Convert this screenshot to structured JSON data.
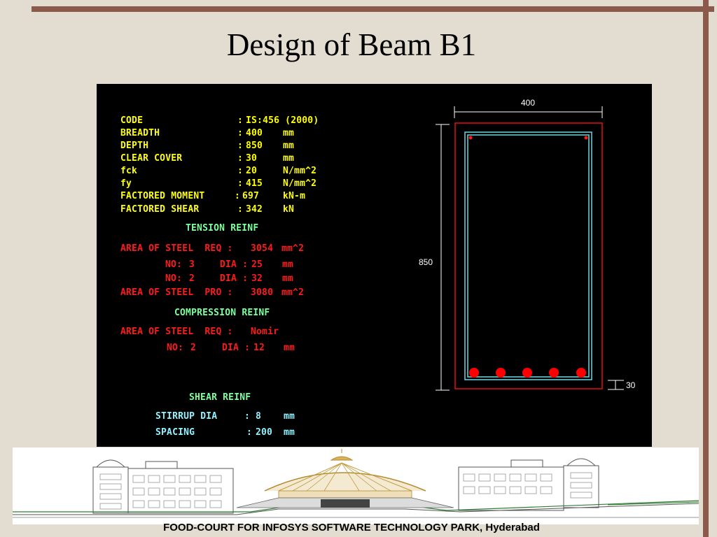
{
  "title": "Design of Beam B1",
  "params": [
    {
      "label": "CODE",
      "sep": ":",
      "value": "IS:456 (2000)",
      "unit": ""
    },
    {
      "label": "BREADTH",
      "sep": ":",
      "value": "400",
      "unit": "mm"
    },
    {
      "label": "DEPTH",
      "sep": ":",
      "value": "850",
      "unit": "mm"
    },
    {
      "label": "CLEAR COVER",
      "sep": ":",
      "value": "30",
      "unit": "mm"
    },
    {
      "label": "fck",
      "sep": ":",
      "value": "20",
      "unit": "N/mm^2"
    },
    {
      "label": "fy",
      "sep": ":",
      "value": "415",
      "unit": "N/mm^2"
    },
    {
      "label": "FACTORED MOMENT",
      "sep": ":",
      "value": "697",
      "unit": "kN-m"
    },
    {
      "label": "FACTORED SHEAR",
      "sep": ":",
      "value": "342",
      "unit": "kN"
    }
  ],
  "tension": {
    "heading": "TENSION REINF",
    "req_label": "AREA OF STEEL  REQ :",
    "req_value": "3054",
    "req_unit": "mm^2",
    "bars": [
      {
        "no_label": "NO:",
        "no": "3",
        "dia_label": "DIA :",
        "dia": "25",
        "unit": "mm"
      },
      {
        "no_label": "NO:",
        "no": "2",
        "dia_label": "DIA :",
        "dia": "32",
        "unit": "mm"
      }
    ],
    "pro_label": "AREA OF STEEL  PRO :",
    "pro_value": "3080",
    "pro_unit": "mm^2"
  },
  "compression": {
    "heading": "COMPRESSION REINF",
    "req_label": "AREA OF STEEL  REQ :",
    "req_value": "Nomir",
    "bar": {
      "no_label": "NO:",
      "no": "2",
      "dia_label": "DIA :",
      "dia": "12",
      "unit": "mm"
    }
  },
  "shear": {
    "heading": "SHEAR REINF",
    "stirrup_label": "STIRRUP DIA",
    "stirrup_value": "8",
    "stirrup_unit": "mm",
    "spacing_label": "SPACING",
    "spacing_value": "200",
    "spacing_unit": "mm"
  },
  "section": {
    "width_label": "400",
    "depth_label": "850",
    "cover_label": "30",
    "bottom_bars": 5,
    "top_bars": 2
  },
  "caption": "FOOD-COURT FOR INFOSYS SOFTWARE TECHNOLOGY PARK, Hyderabad"
}
